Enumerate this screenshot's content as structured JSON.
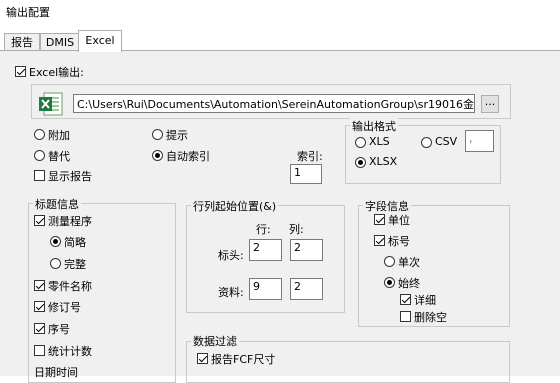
{
  "window": {
    "title": "输出配置"
  },
  "tabs": [
    {
      "label": "报告",
      "active": false
    },
    {
      "label": "DMIS",
      "active": false
    },
    {
      "label": "Excel",
      "active": true
    }
  ],
  "excel": {
    "enable_label": "Excel输出:",
    "enable_checked": true,
    "file_path": "C:\\Users\\Rui\\Documents\\Automation\\SereinAutomationGroup\\sr19016金霸王\\2019050(",
    "browse_label": "...",
    "icon": "excel-icon",
    "modes": [
      {
        "label": "附加",
        "checked": false
      },
      {
        "label": "替代",
        "checked": false
      },
      {
        "label": "提示",
        "checked": false
      },
      {
        "label": "自动索引",
        "checked": true
      }
    ],
    "show_report": {
      "label": "显示报告",
      "checked": false
    },
    "index": {
      "label": "索引:",
      "value": "1"
    },
    "output_format": {
      "title": "输出格式",
      "options": [
        {
          "label": "XLS",
          "checked": false
        },
        {
          "label": "CSV",
          "checked": false
        },
        {
          "label": "XLSX",
          "checked": true
        }
      ],
      "csv_separator_value": ","
    }
  },
  "title_info": {
    "title": "标题信息",
    "items": [
      {
        "label": "测量程序",
        "checked": true
      },
      {
        "label": "简略",
        "checked": true,
        "type": "radio"
      },
      {
        "label": "完整",
        "checked": false,
        "type": "radio"
      },
      {
        "label": "零件名称",
        "checked": true
      },
      {
        "label": "修订号",
        "checked": true
      },
      {
        "label": "序号",
        "checked": true
      },
      {
        "label": "统计计数",
        "checked": false
      },
      {
        "label": "日期时间",
        "checked": false
      }
    ]
  },
  "row_col_start": {
    "title": "行列起始位置(&)",
    "row_header": "行:",
    "col_header": "列:",
    "header_label": "标头:",
    "header_row": "2",
    "header_col": "2",
    "data_label": "资料:",
    "data_row": "9",
    "data_col": "2"
  },
  "field_info": {
    "title": "字段信息",
    "unit": {
      "label": "单位",
      "checked": true
    },
    "label_cb": {
      "label": "标号",
      "checked": true
    },
    "single": {
      "label": "单次",
      "checked": false
    },
    "always": {
      "label": "始终",
      "checked": true
    },
    "detail": {
      "label": "详细",
      "checked": true
    },
    "delete_empty": {
      "label": "删除空",
      "checked": false
    }
  },
  "data_filter": {
    "title": "数据过滤",
    "report_fcf": {
      "label": "报告FCF尺寸",
      "checked": true
    }
  }
}
